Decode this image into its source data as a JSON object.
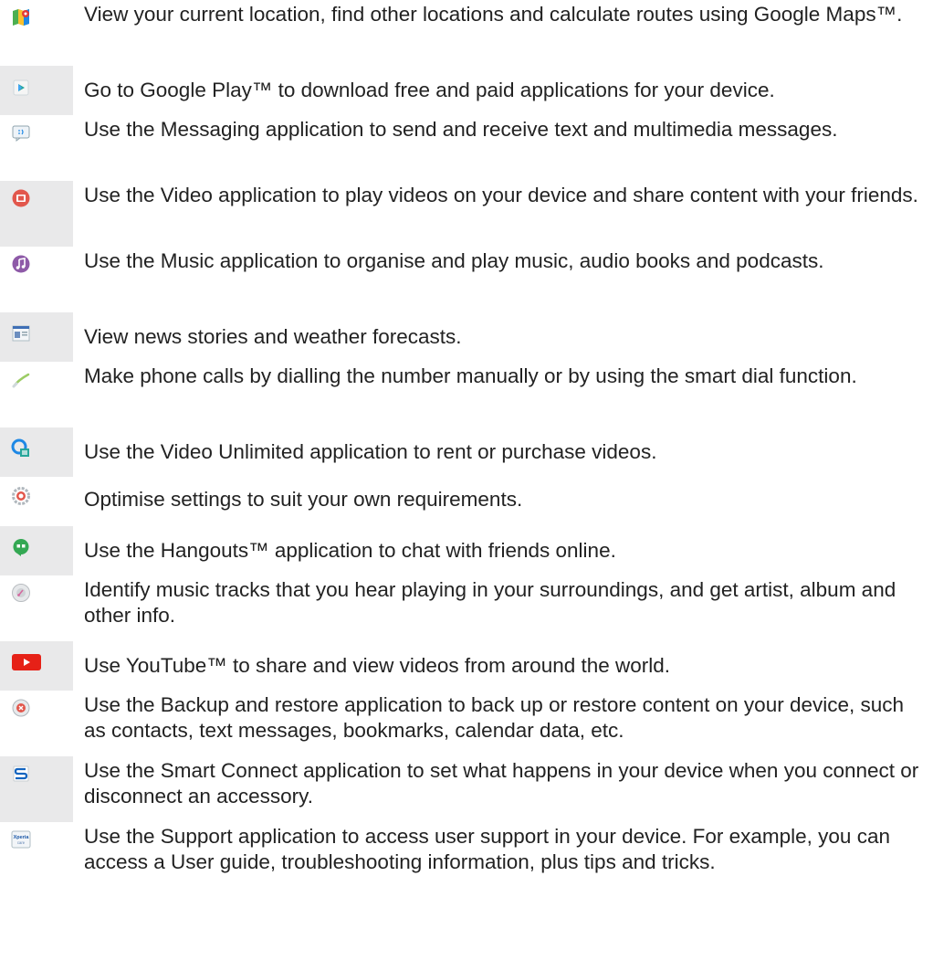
{
  "items": [
    {
      "icon": "maps-icon",
      "text": "View your current location, find other locations and calculate routes using Google Maps™."
    },
    {
      "icon": "play-store-icon",
      "text": "Go to Google Play™ to download free and paid applications for your device."
    },
    {
      "icon": "messaging-icon",
      "text": "Use the Messaging application to send and receive text and multimedia messages."
    },
    {
      "icon": "video-icon",
      "text": "Use the Video application to play videos on your device and share content with your friends."
    },
    {
      "icon": "music-icon",
      "text": "Use the Music application to organise and play music, audio books and podcasts."
    },
    {
      "icon": "news-weather-icon",
      "text": "View news stories and weather forecasts."
    },
    {
      "icon": "phone-icon",
      "text": "Make phone calls by dialling the number manually or by using the smart dial function."
    },
    {
      "icon": "video-unlimited-icon",
      "text": "Use the Video Unlimited application to rent or purchase videos."
    },
    {
      "icon": "settings-icon",
      "text": "Optimise settings to suit your own requirements."
    },
    {
      "icon": "hangouts-icon",
      "text": "Use the Hangouts™ application to chat with friends online."
    },
    {
      "icon": "trackid-icon",
      "text": "Identify music tracks that you hear playing in your surroundings, and get artist, album and other info."
    },
    {
      "icon": "youtube-icon",
      "text": "Use YouTube™ to share and view videos from around the world."
    },
    {
      "icon": "backup-restore-icon",
      "text": "Use the Backup and restore application to back up or restore content on your device, such as contacts, text messages, bookmarks, calendar data, etc."
    },
    {
      "icon": "smart-connect-icon",
      "text": "Use the Smart Connect application to set what happens in your device when you connect or disconnect an accessory."
    },
    {
      "icon": "support-icon",
      "text": "Use the Support application to access user support in your device. For example, you can access a User guide, troubleshooting information, plus tips and tricks.",
      "icon_label": "Xperia care"
    }
  ],
  "colors": {
    "shade": "#e9e9ea",
    "text": "#222222"
  }
}
